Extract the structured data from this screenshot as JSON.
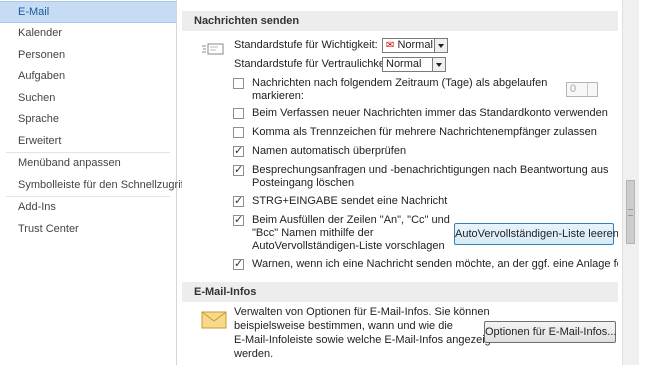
{
  "sidebar": {
    "items": [
      {
        "label": "E-Mail",
        "selected": true
      },
      {
        "label": "Kalender"
      },
      {
        "label": "Personen"
      },
      {
        "label": "Aufgaben"
      },
      {
        "label": "Suchen"
      },
      {
        "label": "Sprache"
      },
      {
        "label": "Erweitert"
      },
      {
        "label": "Menüband anpassen"
      },
      {
        "label": "Symbolleiste für den Schnellzugriff"
      },
      {
        "label": "Add-Ins"
      },
      {
        "label": "Trust Center"
      }
    ]
  },
  "send": {
    "header": "Nachrichten senden",
    "importance_label": "Standardstufe für Wichtigkeit:",
    "importance_value": "Normal",
    "sensitivity_label": "Standardstufe für Vertraulichkeit:",
    "sensitivity_value": "Normal",
    "expire_label_1": "Nachrichten nach folgendem Zeitraum (Tage) als abgelaufen",
    "expire_label_2": "markieren:",
    "expire_days": "0",
    "opt_default_account": "Beim Verfassen neuer Nachrichten immer das Standardkonto verwenden",
    "opt_comma": "Komma als Trennzeichen für mehrere Nachrichtenempfänger zulassen",
    "opt_check_names": "Namen automatisch überprüfen",
    "opt_delete_meeting_1": "Besprechungsanfragen und -benachrichtigungen nach Beantwortung aus",
    "opt_delete_meeting_2": "Posteingang löschen",
    "opt_ctrl_enter": "STRG+EINGABE sendet eine Nachricht",
    "opt_autocomplete_1": "Beim Ausfüllen der Zeilen \"An\", \"Cc\" und",
    "opt_autocomplete_2": "\"Bcc\" Namen mithilfe der",
    "opt_autocomplete_3": "AutoVervollständigen-Liste vorschlagen",
    "clear_autocomplete_button": "AutoVervollständigen-Liste leeren",
    "opt_warn_attachment": "Warnen, wenn ich eine Nachricht senden möchte, an der ggf. eine Anlage fehlt",
    "checks": {
      "expire": false,
      "default_account": false,
      "comma": false,
      "check_names": true,
      "delete_meeting": true,
      "ctrl_enter": true,
      "autocomplete": true,
      "warn_attachment": true
    }
  },
  "mailtips": {
    "header": "E-Mail-Infos",
    "desc_1": "Verwalten von Optionen für E-Mail-Infos. Sie können",
    "desc_2": "beispielsweise bestimmen, wann und wie die",
    "desc_3": "E-Mail-Infoleiste sowie welche E-Mail-Infos angezeigt",
    "desc_4": "werden.",
    "options_button": "Optionen für E-Mail-Infos..."
  },
  "colors": {
    "selected_bg": "#c5dcf4",
    "selected_text": "#1b5a9a",
    "header_bg": "#ededed"
  }
}
